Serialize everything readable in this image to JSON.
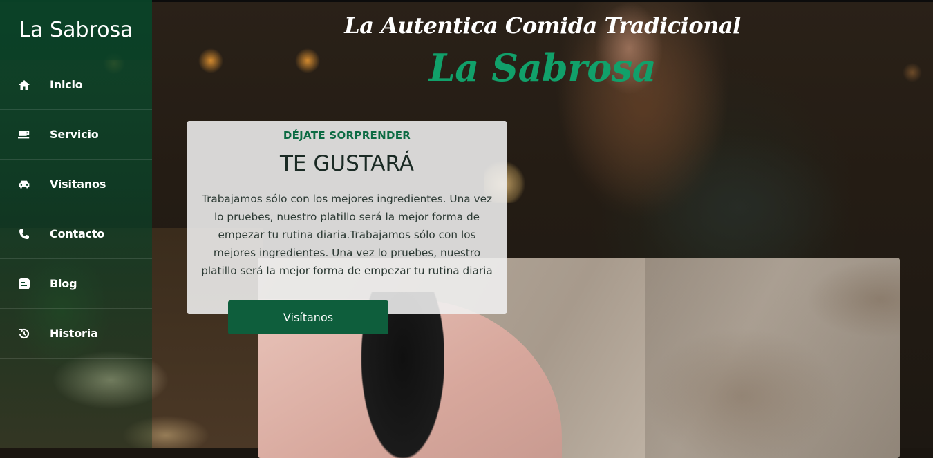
{
  "sidebar": {
    "brand": "La Sabrosa",
    "items": [
      {
        "label": "Inicio",
        "icon": "home-icon"
      },
      {
        "label": "Servicio",
        "icon": "coffee-cup-icon"
      },
      {
        "label": "Visitanos",
        "icon": "car-icon"
      },
      {
        "label": "Contacto",
        "icon": "phone-icon"
      },
      {
        "label": "Blog",
        "icon": "blog-icon"
      },
      {
        "label": "Historia",
        "icon": "history-icon"
      }
    ]
  },
  "hero": {
    "subtitle": "La Autentica Comida Tradicional",
    "title": "La Sabrosa"
  },
  "card": {
    "kicker": "DÉJATE SORPRENDER",
    "heading": "TE GUSTARÁ",
    "body": "Trabajamos sólo con los mejores ingredientes. Una vez lo pruebes, nuestro platillo será la mejor forma de empezar tu rutina diaria.Trabajamos sólo con los mejores ingredientes. Una vez lo pruebes, nuestro platillo será la mejor forma de empezar tu rutina diaria",
    "button": "Visítanos"
  },
  "colors": {
    "accent": "#11a06a",
    "sidebar": "#0b482b",
    "button": "#0e5e3c",
    "kicker": "#0c6b43"
  }
}
